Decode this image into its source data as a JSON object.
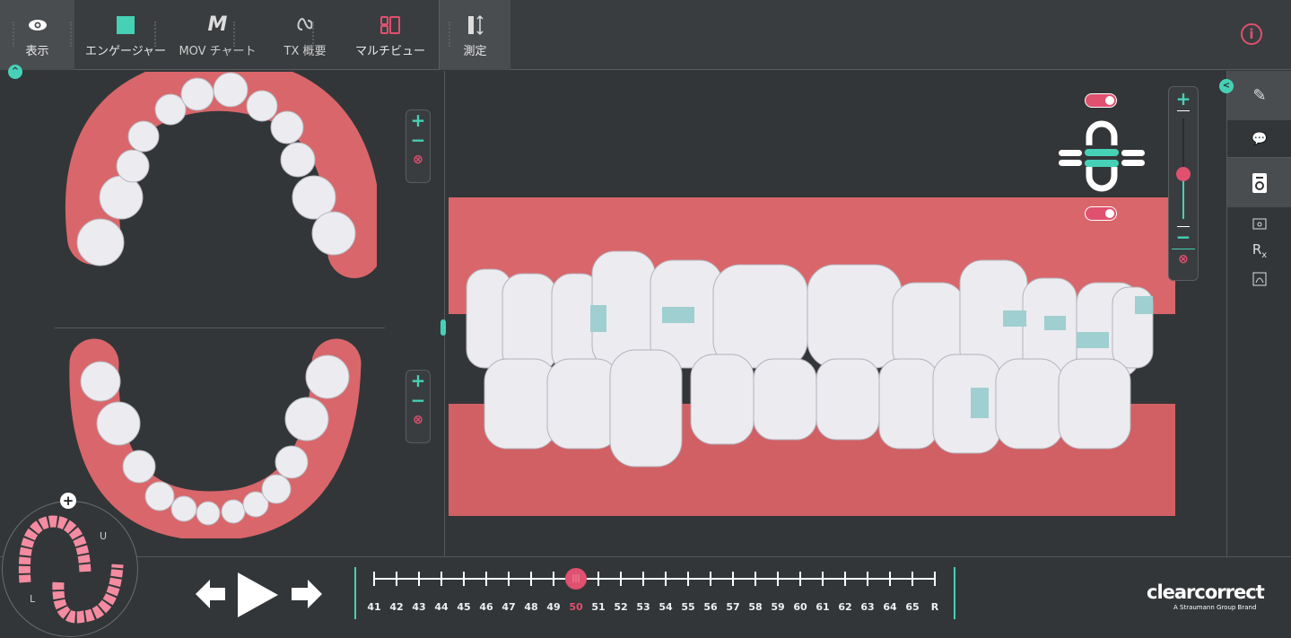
{
  "toolbar": {
    "tabs": [
      {
        "label": "表示",
        "icon": "eye-icon",
        "active": true
      },
      {
        "label": "エンゲージャー",
        "icon": "engager-square-icon"
      },
      {
        "label": "MOV チャート",
        "icon": "m-icon",
        "icon_text": "M"
      },
      {
        "label": "TX 概要",
        "icon": "tx-overview-icon"
      },
      {
        "label": "マルチビュー",
        "icon": "multiview-icon"
      },
      {
        "label": "測定",
        "icon": "measure-icon",
        "active": true
      }
    ],
    "info_icon": "i"
  },
  "minimap": {
    "upper_label": "U",
    "lower_label": "L"
  },
  "timeline": {
    "stages": [
      "41",
      "42",
      "43",
      "44",
      "45",
      "46",
      "47",
      "48",
      "49",
      "50",
      "51",
      "52",
      "53",
      "54",
      "55",
      "56",
      "57",
      "58",
      "59",
      "60",
      "61",
      "62",
      "63",
      "64",
      "65",
      "R"
    ],
    "current": "50"
  },
  "logo": {
    "name": "clearcorrect",
    "tagline": "A Straumann Group Brand"
  },
  "colors": {
    "accent": "#46d1b6",
    "highlight": "#e0506f",
    "gum": "#d9666a",
    "tooth": "#ecebf0",
    "background": "#333638"
  },
  "zoom_slider": {
    "level": 0.45
  }
}
